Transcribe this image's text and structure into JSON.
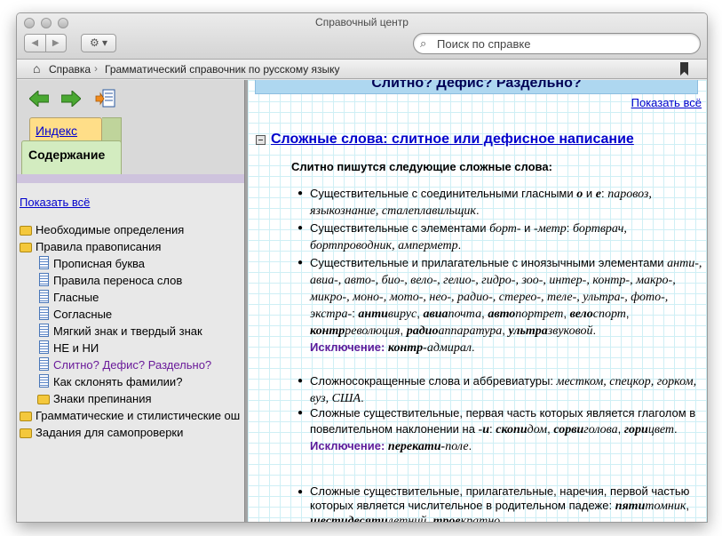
{
  "window": {
    "title": "Справочный центр"
  },
  "toolbar": {
    "back_glyph": "◀",
    "forward_glyph": "▶",
    "gear_glyph": "⚙ ▾",
    "search_placeholder": "Поиск по справке"
  },
  "breadcrumb": {
    "home": "Справка",
    "separator": "›",
    "current": "Грамматический справочник по русскому языку"
  },
  "sidebar": {
    "tab_index": "Индекс",
    "tab_contents": "Содержание",
    "show_all": "Показать всё",
    "tree": [
      {
        "type": "folder",
        "level": 0,
        "label": "Необходимые определения"
      },
      {
        "type": "folder",
        "level": 0,
        "label": "Правила правописания"
      },
      {
        "type": "doc",
        "level": 1,
        "label": "Прописная буква"
      },
      {
        "type": "doc",
        "level": 1,
        "label": "Правила переноса слов"
      },
      {
        "type": "doc",
        "level": 1,
        "label": "Гласные"
      },
      {
        "type": "doc",
        "level": 1,
        "label": "Согласные"
      },
      {
        "type": "doc",
        "level": 1,
        "label": "Мягкий знак и твердый знак"
      },
      {
        "type": "doc",
        "level": 1,
        "label": "НЕ и НИ"
      },
      {
        "type": "doc",
        "level": 1,
        "label": "Слитно? Дефис? Раздельно?",
        "current": true
      },
      {
        "type": "doc",
        "level": 1,
        "label": "Как склонять фамилии?"
      },
      {
        "type": "folder",
        "level": 1,
        "label": "Знаки препинания"
      },
      {
        "type": "folder",
        "level": 0,
        "label": "Грамматические и стилистические ош"
      },
      {
        "type": "folder",
        "level": 0,
        "label": "Задания для самопроверки"
      }
    ]
  },
  "content": {
    "header": "Слитно? Дефис? Раздельно?",
    "show_all": "Показать всё",
    "section_title": "Сложные слова: слитное или дефисное написание",
    "intro": "Слитно пишутся следующие сложные слова:",
    "bullet_glyph": "●",
    "exception_label": "Исключение:",
    "items": {
      "i1": {
        "t1": "Существительные с соединительными гласными ",
        "b1": "о",
        "t2": " и ",
        "b2": "е",
        "t3": ": ",
        "e1": "паровоз, языкознание, сталеплавильщик",
        "t4": "."
      },
      "i2": {
        "t1": "Существительные с элементами ",
        "e1": "борт-",
        "t2": " и ",
        "e2": "-метр",
        "t3": ": ",
        "e3": "бортврач, бортпроводник, амперметр",
        "t4": "."
      },
      "i3": {
        "t1": "Существительные и прилагательные с иноязычными элементами ",
        "e1": "анти-, авиа-, авто-, био-, вело-, гелио-, гидро-, зоо-, интер-, контр-, макро-, микро-, моно-, мото-, нео-, радио-, стерео-, теле-, ультра-, фото-, экстра-",
        "t2": ": ",
        "b1": "анти",
        "e2": "вирус",
        "t3": ", ",
        "b2": "авиа",
        "e3": "почта",
        "t4": ", ",
        "b3": "авто",
        "e4": "портрет",
        "t5": ", ",
        "b4": "вело",
        "e5": "спорт",
        "t6": ", ",
        "b5": "контр",
        "e6": "революция",
        "t7": ", ",
        "b6": "радио",
        "e7": "аппаратура",
        "t8": ", ",
        "b7": "ультра",
        "e8": "звуковой",
        "t9": ".",
        "exc_b": "контр-",
        "exc_e": "адмирал",
        "exc_t": "."
      },
      "i4": {
        "t1": "Сложносокращенные слова и аббревиатуры: ",
        "e1": "местком, спецкор, горком, вуз, США",
        "t2": "."
      },
      "i5": {
        "t1": "Сложные существительные, первая часть которых является глаголом в повелительном наклонении на ",
        "b1": "-и",
        "t2": ": ",
        "b2": "скопи",
        "e1": "дом",
        "t3": ", ",
        "b3": "сорви",
        "e2": "голова",
        "t4": ", ",
        "b4": "гори",
        "e3": "цвет",
        "t5": ".",
        "exc_b": "перекати-",
        "exc_e": "поле",
        "exc_t": "."
      },
      "i6": {
        "t1": "Сложные существительные, прилагательные, наречия, первой частью которых является числительное в родительном падеже: ",
        "b1": "пяти",
        "e1": "томник",
        "t2": ", ",
        "b2": "шестидесяти",
        "e2": "летний",
        "t3": ", ",
        "b3": "трое",
        "e3": "кратно",
        "t4": "."
      }
    }
  }
}
